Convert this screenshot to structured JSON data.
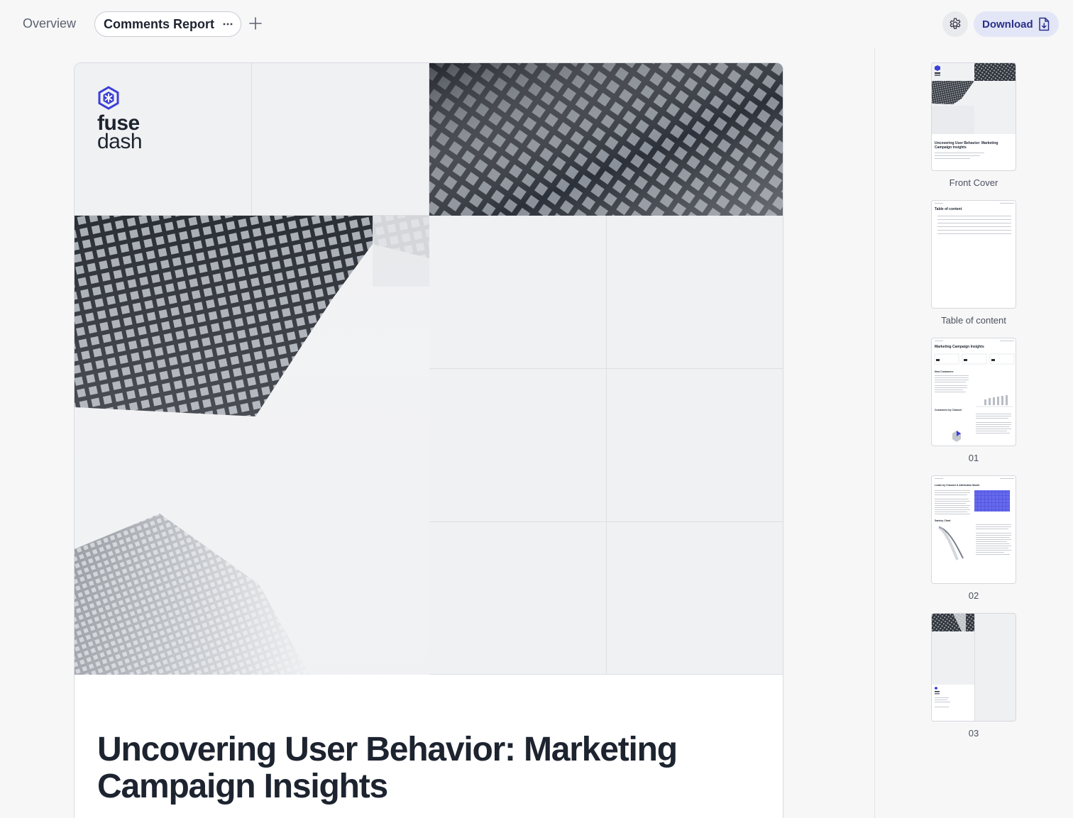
{
  "tabs": {
    "overview": "Overview",
    "active": "Comments Report"
  },
  "toolbar": {
    "download_label": "Download"
  },
  "cover": {
    "logo_line1": "fuse",
    "logo_line2": "dash",
    "title": "Uncovering User Behavior: Marketing Campaign Insights"
  },
  "thumbnails": [
    {
      "label": "Front Cover",
      "title": "Uncovering User Behavior: Marketing Campaign Insights"
    },
    {
      "label": "Table of content",
      "title": "Table of content"
    },
    {
      "label": "01",
      "title": "Marketing Campaign Insights",
      "sub1": "New Customers",
      "sub2": "Customers by Channel"
    },
    {
      "label": "02",
      "title": "Leads by Channel & Attribution Model",
      "sub1": "Sankey Chart"
    },
    {
      "label": "03"
    }
  ],
  "colors": {
    "brand": "#3b3fd8",
    "download_bg": "#e3e6f6",
    "download_text": "#2a2f8a"
  }
}
